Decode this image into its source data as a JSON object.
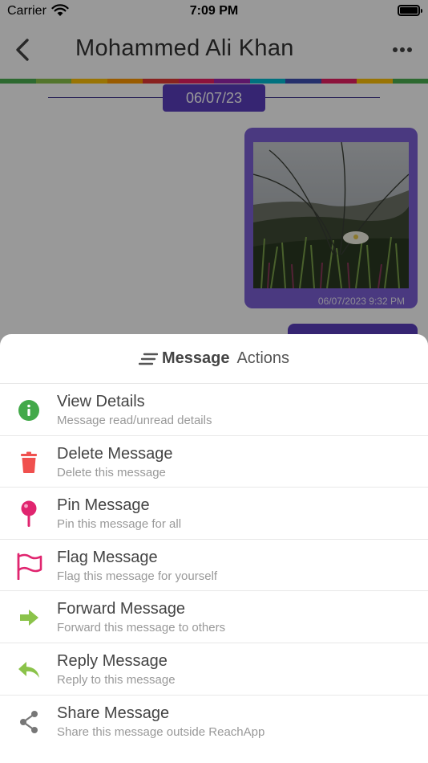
{
  "status_bar": {
    "carrier": "Carrier",
    "time": "7:09 PM"
  },
  "chat": {
    "title": "Mohammed Ali Khan",
    "date_separator": "06/07/23",
    "image_message_time": "06/07/2023 9:32 PM"
  },
  "colors": {
    "accent": "#5b3fbf",
    "bubble": "#7c5fd6",
    "info_icon": "#43a94a",
    "delete_icon": "#f0504e",
    "pin_flag_icon": "#e0256f",
    "forward_reply_icon": "#8bc34a",
    "share_icon": "#777777"
  },
  "rainbow": [
    "#4caf50",
    "#8bc34a",
    "#ffc107",
    "#ff9800",
    "#e53935",
    "#e91e63",
    "#9c27b0",
    "#00bcd4",
    "#3f51b5",
    "#e91e63",
    "#ffc107",
    "#4caf50"
  ],
  "sheet": {
    "title_bold": "Message",
    "title_light": "Actions",
    "actions": [
      {
        "icon": "info-icon",
        "title": "View Details",
        "subtitle": "Message read/unread details"
      },
      {
        "icon": "trash-icon",
        "title": "Delete Message",
        "subtitle": "Delete this message"
      },
      {
        "icon": "pin-icon",
        "title": "Pin Message",
        "subtitle": "Pin this message for all"
      },
      {
        "icon": "flag-icon",
        "title": "Flag Message",
        "subtitle": "Flag this message for yourself"
      },
      {
        "icon": "forward-arrow-icon",
        "title": "Forward Message",
        "subtitle": "Forward this message to others"
      },
      {
        "icon": "reply-arrow-icon",
        "title": "Reply Message",
        "subtitle": "Reply to this message"
      },
      {
        "icon": "share-icon",
        "title": "Share Message",
        "subtitle": "Share this message outside ReachApp"
      }
    ]
  }
}
